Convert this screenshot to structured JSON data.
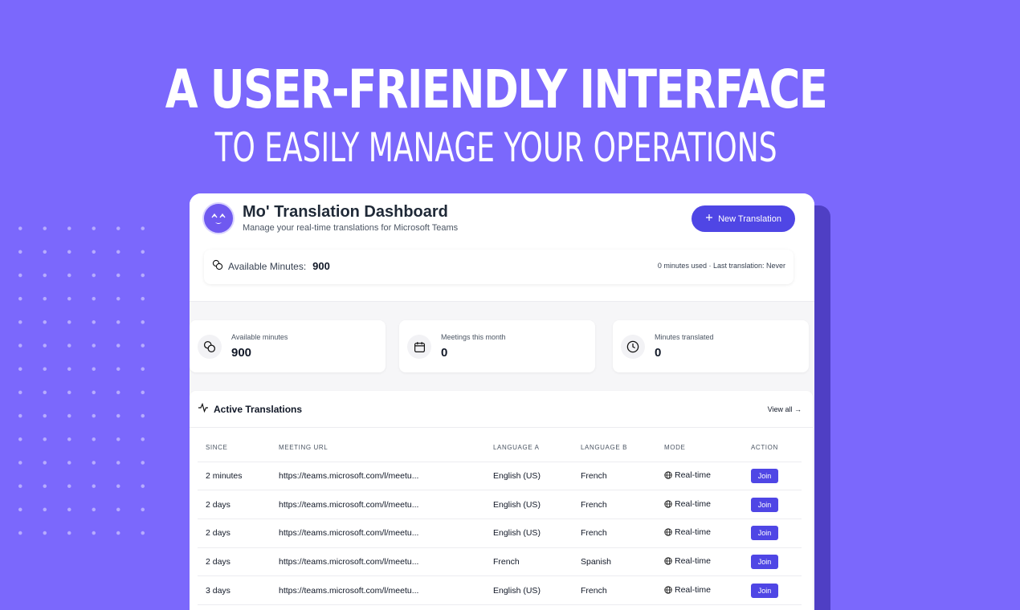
{
  "hero": {
    "headline": "A USER-FRIENDLY INTERFACE",
    "subheadline": "TO EASILY MANAGE YOUR OPERATIONS"
  },
  "colors": {
    "background": "#7b68fc",
    "accent": "#4f46e5",
    "shadow_panel": "#4f3fc4"
  },
  "header": {
    "title": "Mo' Translation Dashboard",
    "subtitle": "Manage your real-time translations for Microsoft Teams",
    "new_button_label": "New Translation",
    "logo_icon": "logo-face-icon"
  },
  "minutes_bar": {
    "label": "Available Minutes:",
    "value": "900",
    "status": "0 minutes used · Last translation: Never",
    "icon": "coins-icon"
  },
  "stats": [
    {
      "label": "Available minutes",
      "value": "900",
      "icon": "coins-icon"
    },
    {
      "label": "Meetings this month",
      "value": "0",
      "icon": "calendar-icon"
    },
    {
      "label": "Minutes translated",
      "value": "0",
      "icon": "clock-icon"
    }
  ],
  "active": {
    "title": "Active Translations",
    "view_all": "View all →",
    "icon": "activity-icon",
    "columns": [
      "SINCE",
      "MEETING URL",
      "LANGUAGE A",
      "LANGUAGE B",
      "MODE",
      "ACTION"
    ],
    "rows": [
      {
        "since": "2 minutes",
        "url": "https://teams.microsoft.com/l/meetu...",
        "lang_a": "English (US)",
        "lang_b": "French",
        "mode": "Real-time",
        "action": "Join"
      },
      {
        "since": "2 days",
        "url": "https://teams.microsoft.com/l/meetu...",
        "lang_a": "English (US)",
        "lang_b": "French",
        "mode": "Real-time",
        "action": "Join"
      },
      {
        "since": "2 days",
        "url": "https://teams.microsoft.com/l/meetu...",
        "lang_a": "English (US)",
        "lang_b": "French",
        "mode": "Real-time",
        "action": "Join"
      },
      {
        "since": "2 days",
        "url": "https://teams.microsoft.com/l/meetu...",
        "lang_a": "French",
        "lang_b": "Spanish",
        "mode": "Real-time",
        "action": "Join"
      },
      {
        "since": "3 days",
        "url": "https://teams.microsoft.com/l/meetu...",
        "lang_a": "English (US)",
        "lang_b": "French",
        "mode": "Real-time",
        "action": "Join"
      }
    ]
  }
}
